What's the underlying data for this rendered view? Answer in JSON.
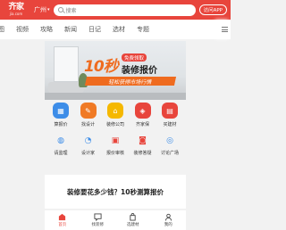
{
  "header": {
    "logo_main": "齐家",
    "logo_sub": "jia.com",
    "city": "广州",
    "search_placeholder": "搜索",
    "app_button": "访问APP"
  },
  "tabs": [
    "图",
    "视频",
    "攻略",
    "新闻",
    "日记",
    "选材",
    "专题"
  ],
  "banner": {
    "big_text": "10秒",
    "badge": "免费领取",
    "price_text": "装修报价",
    "strip_text": "轻松获得市场行情"
  },
  "grid": {
    "row1": [
      {
        "label": "算报价",
        "icon": "calculator-icon",
        "color": "#3d8de8"
      },
      {
        "label": "找设计",
        "icon": "design-icon",
        "color": "#f07a25"
      },
      {
        "label": "装修公司",
        "icon": "company-icon",
        "color": "#f5b800"
      },
      {
        "label": "齐家保",
        "icon": "shield-icon",
        "color": "#e8453c"
      },
      {
        "label": "买建材",
        "icon": "cart-icon",
        "color": "#e8453c"
      }
    ],
    "row2": [
      {
        "label": "请监理",
        "icon": "supervisor-icon",
        "color": "#3d8de8"
      },
      {
        "label": "设计家",
        "icon": "designer-icon",
        "color": "#3d8de8"
      },
      {
        "label": "报价审核",
        "icon": "audit-icon",
        "color": "#e8453c"
      },
      {
        "label": "装修答疑",
        "icon": "qa-icon",
        "color": "#e8453c"
      },
      {
        "label": "讨论广场",
        "icon": "discussion-icon",
        "color": "#3d8de8"
      }
    ]
  },
  "card": {
    "title": "装修要花多少钱？10秒测算报价"
  },
  "bottom_nav": [
    {
      "label": "首页",
      "icon": "home-icon",
      "active": true
    },
    {
      "label": "找装修",
      "icon": "chat-icon",
      "active": false
    },
    {
      "label": "选建材",
      "icon": "bag-icon",
      "active": false
    },
    {
      "label": "我的",
      "icon": "user-icon",
      "active": false
    }
  ],
  "colors": {
    "brand": "#e8453c",
    "accent": "#ef6b1f"
  }
}
